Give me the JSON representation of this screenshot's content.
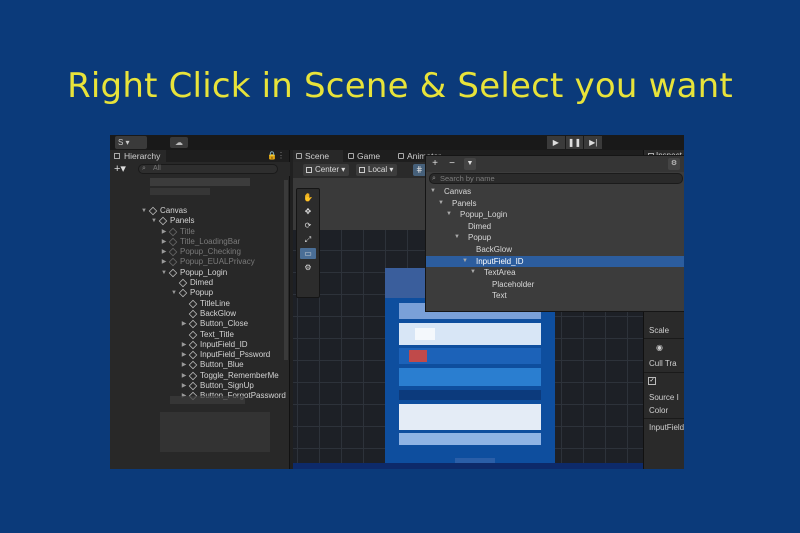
{
  "headline": "Right Click in Scene & Select you want",
  "toolbar": {
    "account": "S ▾",
    "play": [
      "▶",
      "❚❚",
      "▶|"
    ]
  },
  "hierarchy": {
    "tab": "Hierarchy",
    "add": "+▾",
    "search_placeholder": "All",
    "items": [
      {
        "label": "Canvas",
        "depth": 0,
        "arrow": "▼",
        "dim": false
      },
      {
        "label": "Panels",
        "depth": 1,
        "arrow": "▼",
        "dim": false
      },
      {
        "label": "Title",
        "depth": 2,
        "arrow": "▶",
        "dim": true
      },
      {
        "label": "Title_LoadingBar",
        "depth": 2,
        "arrow": "▶",
        "dim": true
      },
      {
        "label": "Popup_Checking",
        "depth": 2,
        "arrow": "▶",
        "dim": true
      },
      {
        "label": "Popup_EUALPrivacy",
        "depth": 2,
        "arrow": "▶",
        "dim": true
      },
      {
        "label": "Popup_Login",
        "depth": 2,
        "arrow": "▼",
        "dim": false
      },
      {
        "label": "Dimed",
        "depth": 3,
        "arrow": "",
        "dim": false
      },
      {
        "label": "Popup",
        "depth": 3,
        "arrow": "▼",
        "dim": false
      },
      {
        "label": "TitleLine",
        "depth": 4,
        "arrow": "",
        "dim": false
      },
      {
        "label": "BackGlow",
        "depth": 4,
        "arrow": "",
        "dim": false
      },
      {
        "label": "Button_Close",
        "depth": 4,
        "arrow": "▶",
        "dim": false
      },
      {
        "label": "Text_Title",
        "depth": 4,
        "arrow": "",
        "dim": false
      },
      {
        "label": "InputField_ID",
        "depth": 4,
        "arrow": "▶",
        "dim": false
      },
      {
        "label": "InputField_Pssword",
        "depth": 4,
        "arrow": "▶",
        "dim": false
      },
      {
        "label": "Button_Blue",
        "depth": 4,
        "arrow": "▶",
        "dim": false
      },
      {
        "label": "Toggle_RememberMe",
        "depth": 4,
        "arrow": "▶",
        "dim": false
      },
      {
        "label": "Button_SignUp",
        "depth": 4,
        "arrow": "▶",
        "dim": false
      },
      {
        "label": "Button_ForgotPassword",
        "depth": 4,
        "arrow": "▶",
        "dim": false
      }
    ]
  },
  "scene": {
    "tabs": [
      "Scene",
      "Game",
      "Animator"
    ],
    "pivot": "Center",
    "space": "Local",
    "tools": [
      "✋",
      "✥",
      "⟳",
      "⤢",
      "▭",
      "⚙"
    ]
  },
  "dropdown": {
    "plus": "+",
    "minus": "−",
    "search_placeholder": "Search by name",
    "items": [
      {
        "label": "Canvas",
        "depth": 0,
        "arrow": "▼",
        "selected": false
      },
      {
        "label": "Panels",
        "depth": 1,
        "arrow": "▼",
        "selected": false
      },
      {
        "label": "Popup_Login",
        "depth": 2,
        "arrow": "▼",
        "selected": false
      },
      {
        "label": "Dimed",
        "depth": 3,
        "arrow": "",
        "selected": false
      },
      {
        "label": "Popup",
        "depth": 3,
        "arrow": "▼",
        "selected": false
      },
      {
        "label": "BackGlow",
        "depth": 4,
        "arrow": "",
        "selected": false
      },
      {
        "label": "InputField_ID",
        "depth": 4,
        "arrow": "▼",
        "selected": true
      },
      {
        "label": "TextArea",
        "depth": 5,
        "arrow": "▼",
        "selected": false
      },
      {
        "label": "Placeholder",
        "depth": 6,
        "arrow": "",
        "selected": false
      },
      {
        "label": "Text",
        "depth": 6,
        "arrow": "",
        "selected": false
      }
    ]
  },
  "inspector": {
    "tab": "Inspect",
    "scale": "Scale",
    "cull": "Cull Tra",
    "source": "Source I",
    "color": "Color",
    "name": "InputField"
  }
}
